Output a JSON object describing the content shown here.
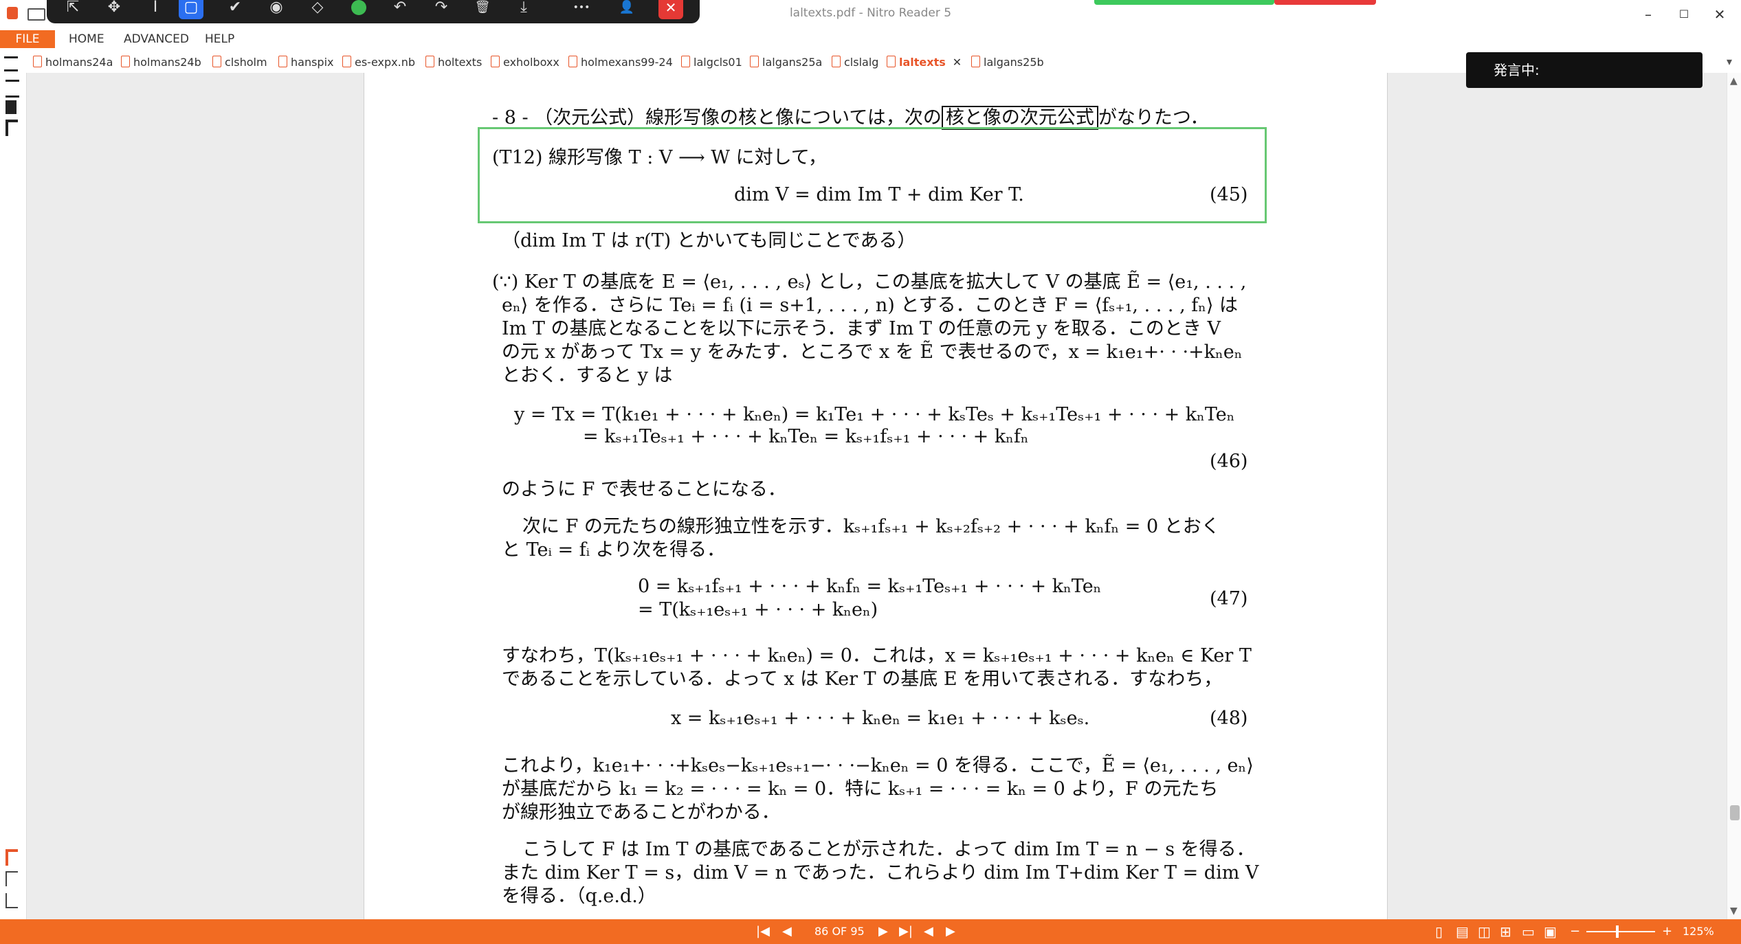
{
  "window": {
    "title": "laltexts.pdf - Nitro Reader 5",
    "minimize": "–",
    "maximize": "☐",
    "close": "✕"
  },
  "float_toolbar": {
    "icons": [
      "select-arrow-icon",
      "pan-icon",
      "text-cursor-icon",
      "rectangle-icon",
      "checkmark-icon",
      "stamp-icon",
      "eraser-icon",
      "color-dot-icon",
      "undo-icon",
      "redo-icon",
      "delete-icon",
      "download-icon",
      "more-icon",
      "user-icon",
      "close-icon"
    ],
    "glyphs": {
      "select": "⇱",
      "pan": "✥",
      "text": "I",
      "rect": "▢",
      "check": "✔",
      "stamp": "◉",
      "eraser": "◇",
      "undo": "↶",
      "redo": "↷",
      "delete": "🗑",
      "download": "⤓",
      "more": "•••",
      "user": "👤",
      "close": "✕"
    }
  },
  "menu": {
    "file": "FILE",
    "home": "HOME",
    "advanced": "ADVANCED",
    "help": "HELP"
  },
  "tabs": [
    {
      "label": "holmans24a"
    },
    {
      "label": "holmans24b"
    },
    {
      "label": "clsholm"
    },
    {
      "label": "hanspix"
    },
    {
      "label": "es-expx.nb"
    },
    {
      "label": "holtexts"
    },
    {
      "label": "exholboxx"
    },
    {
      "label": "holmexans99-24"
    },
    {
      "label": "lalgcls01"
    },
    {
      "label": "lalgans25a"
    },
    {
      "label": "clslalg"
    },
    {
      "label": "laltexts"
    },
    {
      "label": "lalgans25b"
    }
  ],
  "active_tab_close": "✕",
  "tabs_more": "▾",
  "speaking_popup": "発言中:",
  "document": {
    "lines": [
      "- 8 - （次元公式）線形写像の核と像については，次の",
      "がなりたつ．",
      "(T12)  線形写像 T : V ⟶ W に対して，",
      "dim V = dim Im T + dim Ker T.",
      "（dim Im T は r(T) とかいても同じことである）",
      "(∵) Ker T の基底を E = ⟨e₁, . . . , eₛ⟩ とし，この基底を拡大して V の基底 Ẽ = ⟨e₁, . . . ,",
      "eₙ⟩ を作る．さらに Teᵢ = fᵢ (i = s+1, . . . , n) とする．このとき F = ⟨fₛ₊₁, . . . , fₙ⟩ は",
      "Im T の基底となることを以下に示そう．まず Im T の任意の元 y を取る．このとき V",
      "の元 x があって Tx = y をみたす．ところで x を Ẽ で表せるので，x = k₁e₁+· · ·+kₙeₙ",
      "とおく．すると y は",
      "y = Tx = T(k₁e₁ + · · · + kₙeₙ) = k₁Te₁ + · · · + kₛTeₛ + kₛ₊₁Teₛ₊₁ + · · · + kₙTeₙ",
      "= kₛ₊₁Teₛ₊₁ + · · · + kₙTeₙ = kₛ₊₁fₛ₊₁ + · · · + kₙfₙ",
      "のように F で表せることになる．",
      "次に F の元たちの線形独立性を示す．kₛ₊₁fₛ₊₁ + kₛ₊₂fₛ₊₂ + · · · + kₙfₙ = 0 とおく",
      "と Teᵢ = fᵢ より次を得る．",
      "0 = kₛ₊₁fₛ₊₁ + · · · + kₙfₙ = kₛ₊₁Teₛ₊₁ + · · · + kₙTeₙ",
      "= T(kₛ₊₁eₛ₊₁ + · · · + kₙeₙ)",
      "すなわち，T(kₛ₊₁eₛ₊₁ + · · · + kₙeₙ) = 0．これは，x = kₛ₊₁eₛ₊₁ + · · · + kₙeₙ ∈ Ker T",
      "であることを示している．よって x は Ker T の基底 E を用いて表される．すなわち，",
      "x = kₛ₊₁eₛ₊₁ + · · · + kₙeₙ = k₁e₁ + · · · + kₛeₛ.",
      "これより，k₁e₁+· · ·+kₛeₛ−kₛ₊₁eₛ₊₁−· · ·−kₙeₙ = 0 を得る．ここで，Ẽ = ⟨e₁, . . . , eₙ⟩",
      "が基底だから k₁ = k₂ = · · · = kₙ = 0．特に kₛ₊₁ = · · · = kₙ = 0 より，F の元たち",
      "が線形独立であることがわかる．",
      "こうして F は Im T の基底であることが示された．よって dim Im T = n − s を得る．",
      "また dim Ker T = s，dim V = n であった．これらより dim Im T+dim Ker T = dim V",
      "を得る．（q.e.d.）"
    ],
    "boxed_term": "核と像の次元公式",
    "eq_numbers": [
      "(45)",
      "(46)",
      "(47)",
      "(48)"
    ]
  },
  "status": {
    "page_indicator": "86 OF 95",
    "zoom": "125%",
    "zoom_minus": "−",
    "zoom_plus": "+"
  }
}
